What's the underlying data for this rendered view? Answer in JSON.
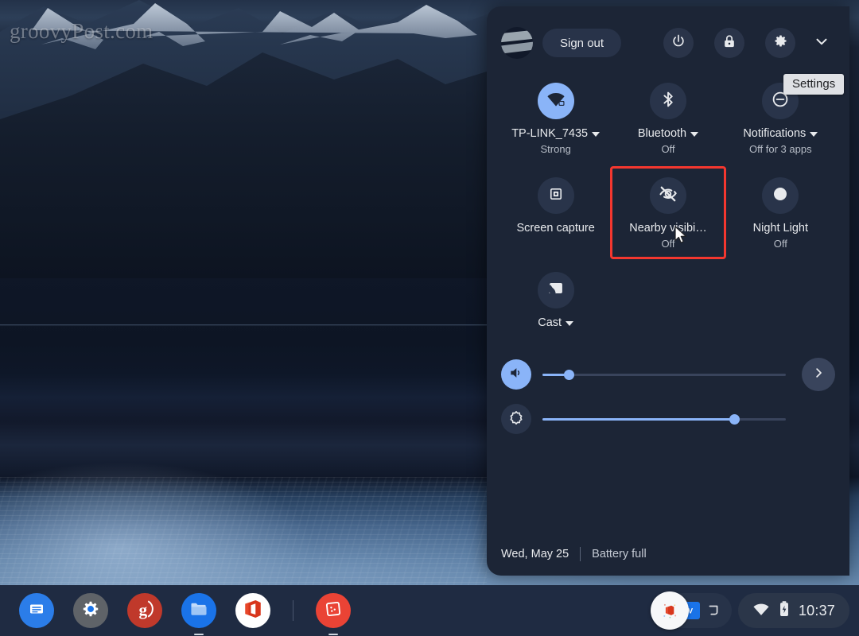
{
  "desktop": {
    "watermark": "groovyPost.com",
    "wallpaper_name": "mountain-lake-wallpaper"
  },
  "quick_settings": {
    "header": {
      "avatar_name": "user-avatar",
      "sign_out_label": "Sign out",
      "power_icon": "power-icon",
      "lock_icon": "lock-icon",
      "settings_icon": "gear-icon",
      "collapse_icon": "chevron-down-icon"
    },
    "tooltip": {
      "text": "Settings"
    },
    "tiles": [
      {
        "name": "network",
        "icon": "wifi-icon",
        "label": "TP-LINK_7435",
        "sub": "Strong",
        "has_caret": true,
        "active": true,
        "highlighted": false
      },
      {
        "name": "bluetooth",
        "icon": "bluetooth-icon",
        "label": "Bluetooth",
        "sub": "Off",
        "has_caret": true,
        "active": false,
        "highlighted": false
      },
      {
        "name": "notifications",
        "icon": "do-not-disturb-icon",
        "label": "Notifications",
        "sub": "Off for 3 apps",
        "has_caret": true,
        "active": false,
        "highlighted": false
      },
      {
        "name": "screen-capture",
        "icon": "screen-capture-icon",
        "label": "Screen capture",
        "sub": "",
        "has_caret": false,
        "active": false,
        "highlighted": false
      },
      {
        "name": "nearby-visibility",
        "icon": "eye-slash-icon",
        "label": "Nearby visibi…",
        "sub": "Off",
        "has_caret": false,
        "active": false,
        "highlighted": true
      },
      {
        "name": "night-light",
        "icon": "moon-icon",
        "label": "Night Light",
        "sub": "Off",
        "has_caret": false,
        "active": false,
        "highlighted": false
      },
      {
        "name": "cast",
        "icon": "cast-icon",
        "label": "Cast",
        "sub": "",
        "has_caret": true,
        "active": false,
        "highlighted": false
      }
    ],
    "sliders": [
      {
        "name": "volume",
        "icon": "volume-icon",
        "value_percent": 11,
        "active": true,
        "expand_icon": "chevron-right-icon"
      },
      {
        "name": "brightness",
        "icon": "brightness-icon",
        "value_percent": 79,
        "active": false,
        "expand_icon": ""
      }
    ],
    "footer": {
      "date": "Wed, May 25",
      "battery": "Battery full"
    },
    "colors": {
      "panel_bg": "#1c2536",
      "accent": "#8ab4f8",
      "highlight_border": "#f4372f",
      "tile_bg": "#29344a"
    }
  },
  "shelf": {
    "apps": [
      {
        "name": "chat-app",
        "icon": "chat-icon",
        "color": "#2b7de9",
        "running": false
      },
      {
        "name": "settings-app",
        "icon": "gear-icon",
        "color": "#5f6368",
        "running": false
      },
      {
        "name": "groovypost-app",
        "icon": "g-letter-icon",
        "color": "#c0392b",
        "running": false
      },
      {
        "name": "files-app",
        "icon": "folder-icon",
        "color": "#1a73e8",
        "running": true
      },
      {
        "name": "office-app",
        "icon": "office-icon",
        "color": "#d83b01",
        "running": false
      },
      {
        "name": "photos-app",
        "icon": "photos-icon",
        "color": "#ea4335",
        "running": true
      }
    ],
    "tray": {
      "wifi_icon": "wifi-icon",
      "battery_icon": "battery-full-icon",
      "time": "10:37"
    }
  }
}
